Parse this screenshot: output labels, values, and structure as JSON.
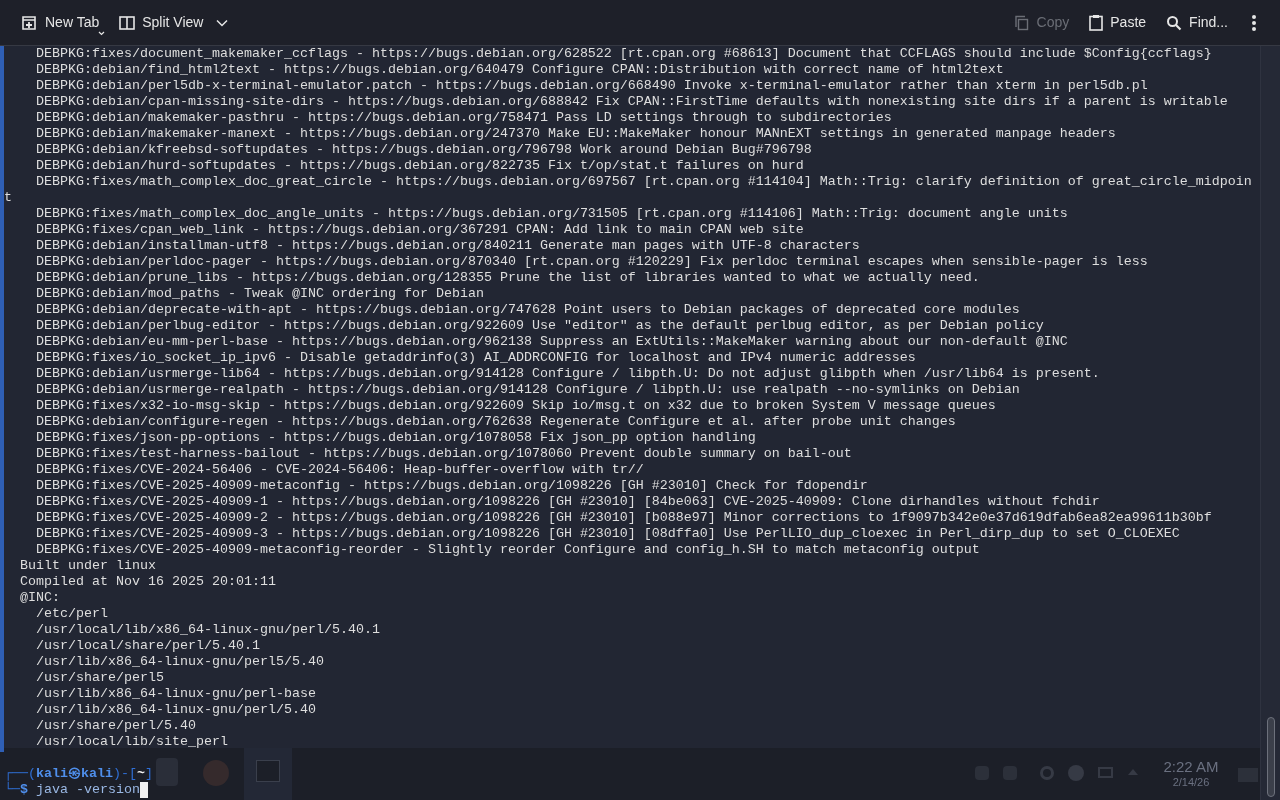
{
  "toolbar": {
    "buttons": [
      {
        "kind": "new-tab",
        "label": "New Tab",
        "disabled": false
      },
      {
        "kind": "split-view",
        "label": "Split View",
        "disabled": false
      },
      {
        "kind": "copy",
        "label": "Copy",
        "disabled": true
      },
      {
        "kind": "paste",
        "label": "Paste",
        "disabled": false
      },
      {
        "kind": "find",
        "label": "Find...",
        "disabled": false
      }
    ]
  },
  "terminal": {
    "lines": [
      {
        "kind": "patch",
        "text": "DEBPKG:fixes/document_makemaker_ccflags - https://bugs.debian.org/628522 [rt.cpan.org #68613] Document that CCFLAGS should include $Config{ccflags}"
      },
      {
        "kind": "patch",
        "text": "DEBPKG:debian/find_html2text - https://bugs.debian.org/640479 Configure CPAN::Distribution with correct name of html2text"
      },
      {
        "kind": "patch",
        "text": "DEBPKG:debian/perl5db-x-terminal-emulator.patch - https://bugs.debian.org/668490 Invoke x-terminal-emulator rather than xterm in perl5db.pl"
      },
      {
        "kind": "patch",
        "text": "DEBPKG:debian/cpan-missing-site-dirs - https://bugs.debian.org/688842 Fix CPAN::FirstTime defaults with nonexisting site dirs if a parent is writable"
      },
      {
        "kind": "patch",
        "text": "DEBPKG:debian/makemaker-pasthru - https://bugs.debian.org/758471 Pass LD settings through to subdirectories"
      },
      {
        "kind": "patch",
        "text": "DEBPKG:debian/makemaker-manext - https://bugs.debian.org/247370 Make EU::MakeMaker honour MANnEXT settings in generated manpage headers"
      },
      {
        "kind": "patch",
        "text": "DEBPKG:debian/kfreebsd-softupdates - https://bugs.debian.org/796798 Work around Debian Bug#796798"
      },
      {
        "kind": "patch",
        "text": "DEBPKG:debian/hurd-softupdates - https://bugs.debian.org/822735 Fix t/op/stat.t failures on hurd"
      },
      {
        "kind": "patch",
        "text": "DEBPKG:fixes/math_complex_doc_great_circle - https://bugs.debian.org/697567 [rt.cpan.org #114104] Math::Trig: clarify definition of great_circle_midpoin"
      },
      {
        "kind": "wrap",
        "text": "t"
      },
      {
        "kind": "patch",
        "text": "DEBPKG:fixes/math_complex_doc_angle_units - https://bugs.debian.org/731505 [rt.cpan.org #114106] Math::Trig: document angle units"
      },
      {
        "kind": "patch",
        "text": "DEBPKG:fixes/cpan_web_link - https://bugs.debian.org/367291 CPAN: Add link to main CPAN web site"
      },
      {
        "kind": "patch",
        "text": "DEBPKG:debian/installman-utf8 - https://bugs.debian.org/840211 Generate man pages with UTF-8 characters"
      },
      {
        "kind": "patch",
        "text": "DEBPKG:debian/perldoc-pager - https://bugs.debian.org/870340 [rt.cpan.org #120229] Fix perldoc terminal escapes when sensible-pager is less"
      },
      {
        "kind": "patch",
        "text": "DEBPKG:debian/prune_libs - https://bugs.debian.org/128355 Prune the list of libraries wanted to what we actually need."
      },
      {
        "kind": "patch",
        "text": "DEBPKG:debian/mod_paths - Tweak @INC ordering for Debian"
      },
      {
        "kind": "patch",
        "text": "DEBPKG:debian/deprecate-with-apt - https://bugs.debian.org/747628 Point users to Debian packages of deprecated core modules"
      },
      {
        "kind": "patch",
        "text": "DEBPKG:debian/perlbug-editor - https://bugs.debian.org/922609 Use \"editor\" as the default perlbug editor, as per Debian policy"
      },
      {
        "kind": "patch",
        "text": "DEBPKG:debian/eu-mm-perl-base - https://bugs.debian.org/962138 Suppress an ExtUtils::MakeMaker warning about our non-default @INC"
      },
      {
        "kind": "patch",
        "text": "DEBPKG:fixes/io_socket_ip_ipv6 - Disable getaddrinfo(3) AI_ADDRCONFIG for localhost and IPv4 numeric addresses"
      },
      {
        "kind": "patch",
        "text": "DEBPKG:debian/usrmerge-lib64 - https://bugs.debian.org/914128 Configure / libpth.U: Do not adjust glibpth when /usr/lib64 is present."
      },
      {
        "kind": "patch",
        "text": "DEBPKG:debian/usrmerge-realpath - https://bugs.debian.org/914128 Configure / libpth.U: use realpath --no-symlinks on Debian"
      },
      {
        "kind": "patch",
        "text": "DEBPKG:fixes/x32-io-msg-skip - https://bugs.debian.org/922609 Skip io/msg.t on x32 due to broken System V message queues"
      },
      {
        "kind": "patch",
        "text": "DEBPKG:debian/configure-regen - https://bugs.debian.org/762638 Regenerate Configure et al. after probe unit changes"
      },
      {
        "kind": "patch",
        "text": "DEBPKG:fixes/json-pp-options - https://bugs.debian.org/1078058 Fix json_pp option handling"
      },
      {
        "kind": "patch",
        "text": "DEBPKG:fixes/test-harness-bailout - https://bugs.debian.org/1078060 Prevent double summary on bail-out"
      },
      {
        "kind": "patch",
        "text": "DEBPKG:fixes/CVE-2024-56406 - CVE-2024-56406: Heap-buffer-overflow with tr//"
      },
      {
        "kind": "patch",
        "text": "DEBPKG:fixes/CVE-2025-40909-metaconfig - https://bugs.debian.org/1098226 [GH #23010] Check for fdopendir"
      },
      {
        "kind": "patch",
        "text": "DEBPKG:fixes/CVE-2025-40909-1 - https://bugs.debian.org/1098226 [GH #23010] [84be063] CVE-2025-40909: Clone dirhandles without fchdir"
      },
      {
        "kind": "patch",
        "text": "DEBPKG:fixes/CVE-2025-40909-2 - https://bugs.debian.org/1098226 [GH #23010] [b088e97] Minor corrections to 1f9097b342e0e37d619dfab6ea82ea99611b30bf"
      },
      {
        "kind": "patch",
        "text": "DEBPKG:fixes/CVE-2025-40909-3 - https://bugs.debian.org/1098226 [GH #23010] [08dffa0] Use PerlLIO_dup_cloexec in Perl_dirp_dup to set O_CLOEXEC"
      },
      {
        "kind": "patch",
        "text": "DEBPKG:fixes/CVE-2025-40909-metaconfig-reorder - Slightly reorder Configure and config_h.SH to match metaconfig output"
      },
      {
        "kind": "info",
        "text": "Built under linux"
      },
      {
        "kind": "info",
        "text": "Compiled at Nov 16 2025 20:01:11"
      },
      {
        "kind": "info",
        "text": "@INC:"
      },
      {
        "kind": "path",
        "text": "/etc/perl"
      },
      {
        "kind": "path",
        "text": "/usr/local/lib/x86_64-linux-gnu/perl/5.40.1"
      },
      {
        "kind": "path",
        "text": "/usr/local/share/perl/5.40.1"
      },
      {
        "kind": "path",
        "text": "/usr/lib/x86_64-linux-gnu/perl5/5.40"
      },
      {
        "kind": "path",
        "text": "/usr/share/perl5"
      },
      {
        "kind": "path",
        "text": "/usr/lib/x86_64-linux-gnu/perl-base"
      },
      {
        "kind": "path",
        "text": "/usr/lib/x86_64-linux-gnu/perl/5.40"
      },
      {
        "kind": "path",
        "text": "/usr/share/perl/5.40"
      },
      {
        "kind": "path",
        "text": "/usr/local/lib/site_perl"
      }
    ],
    "prompt": {
      "open": "┌──(",
      "user": "kali",
      "at": "㉿",
      "host": "kali",
      "mid": ")-[",
      "cwd": "~",
      "close": "]",
      "corner": "└─",
      "symbol": "$",
      "command": "java -version"
    }
  },
  "taskbar": {
    "time": "2:22 AM",
    "date": "2/14/26"
  }
}
